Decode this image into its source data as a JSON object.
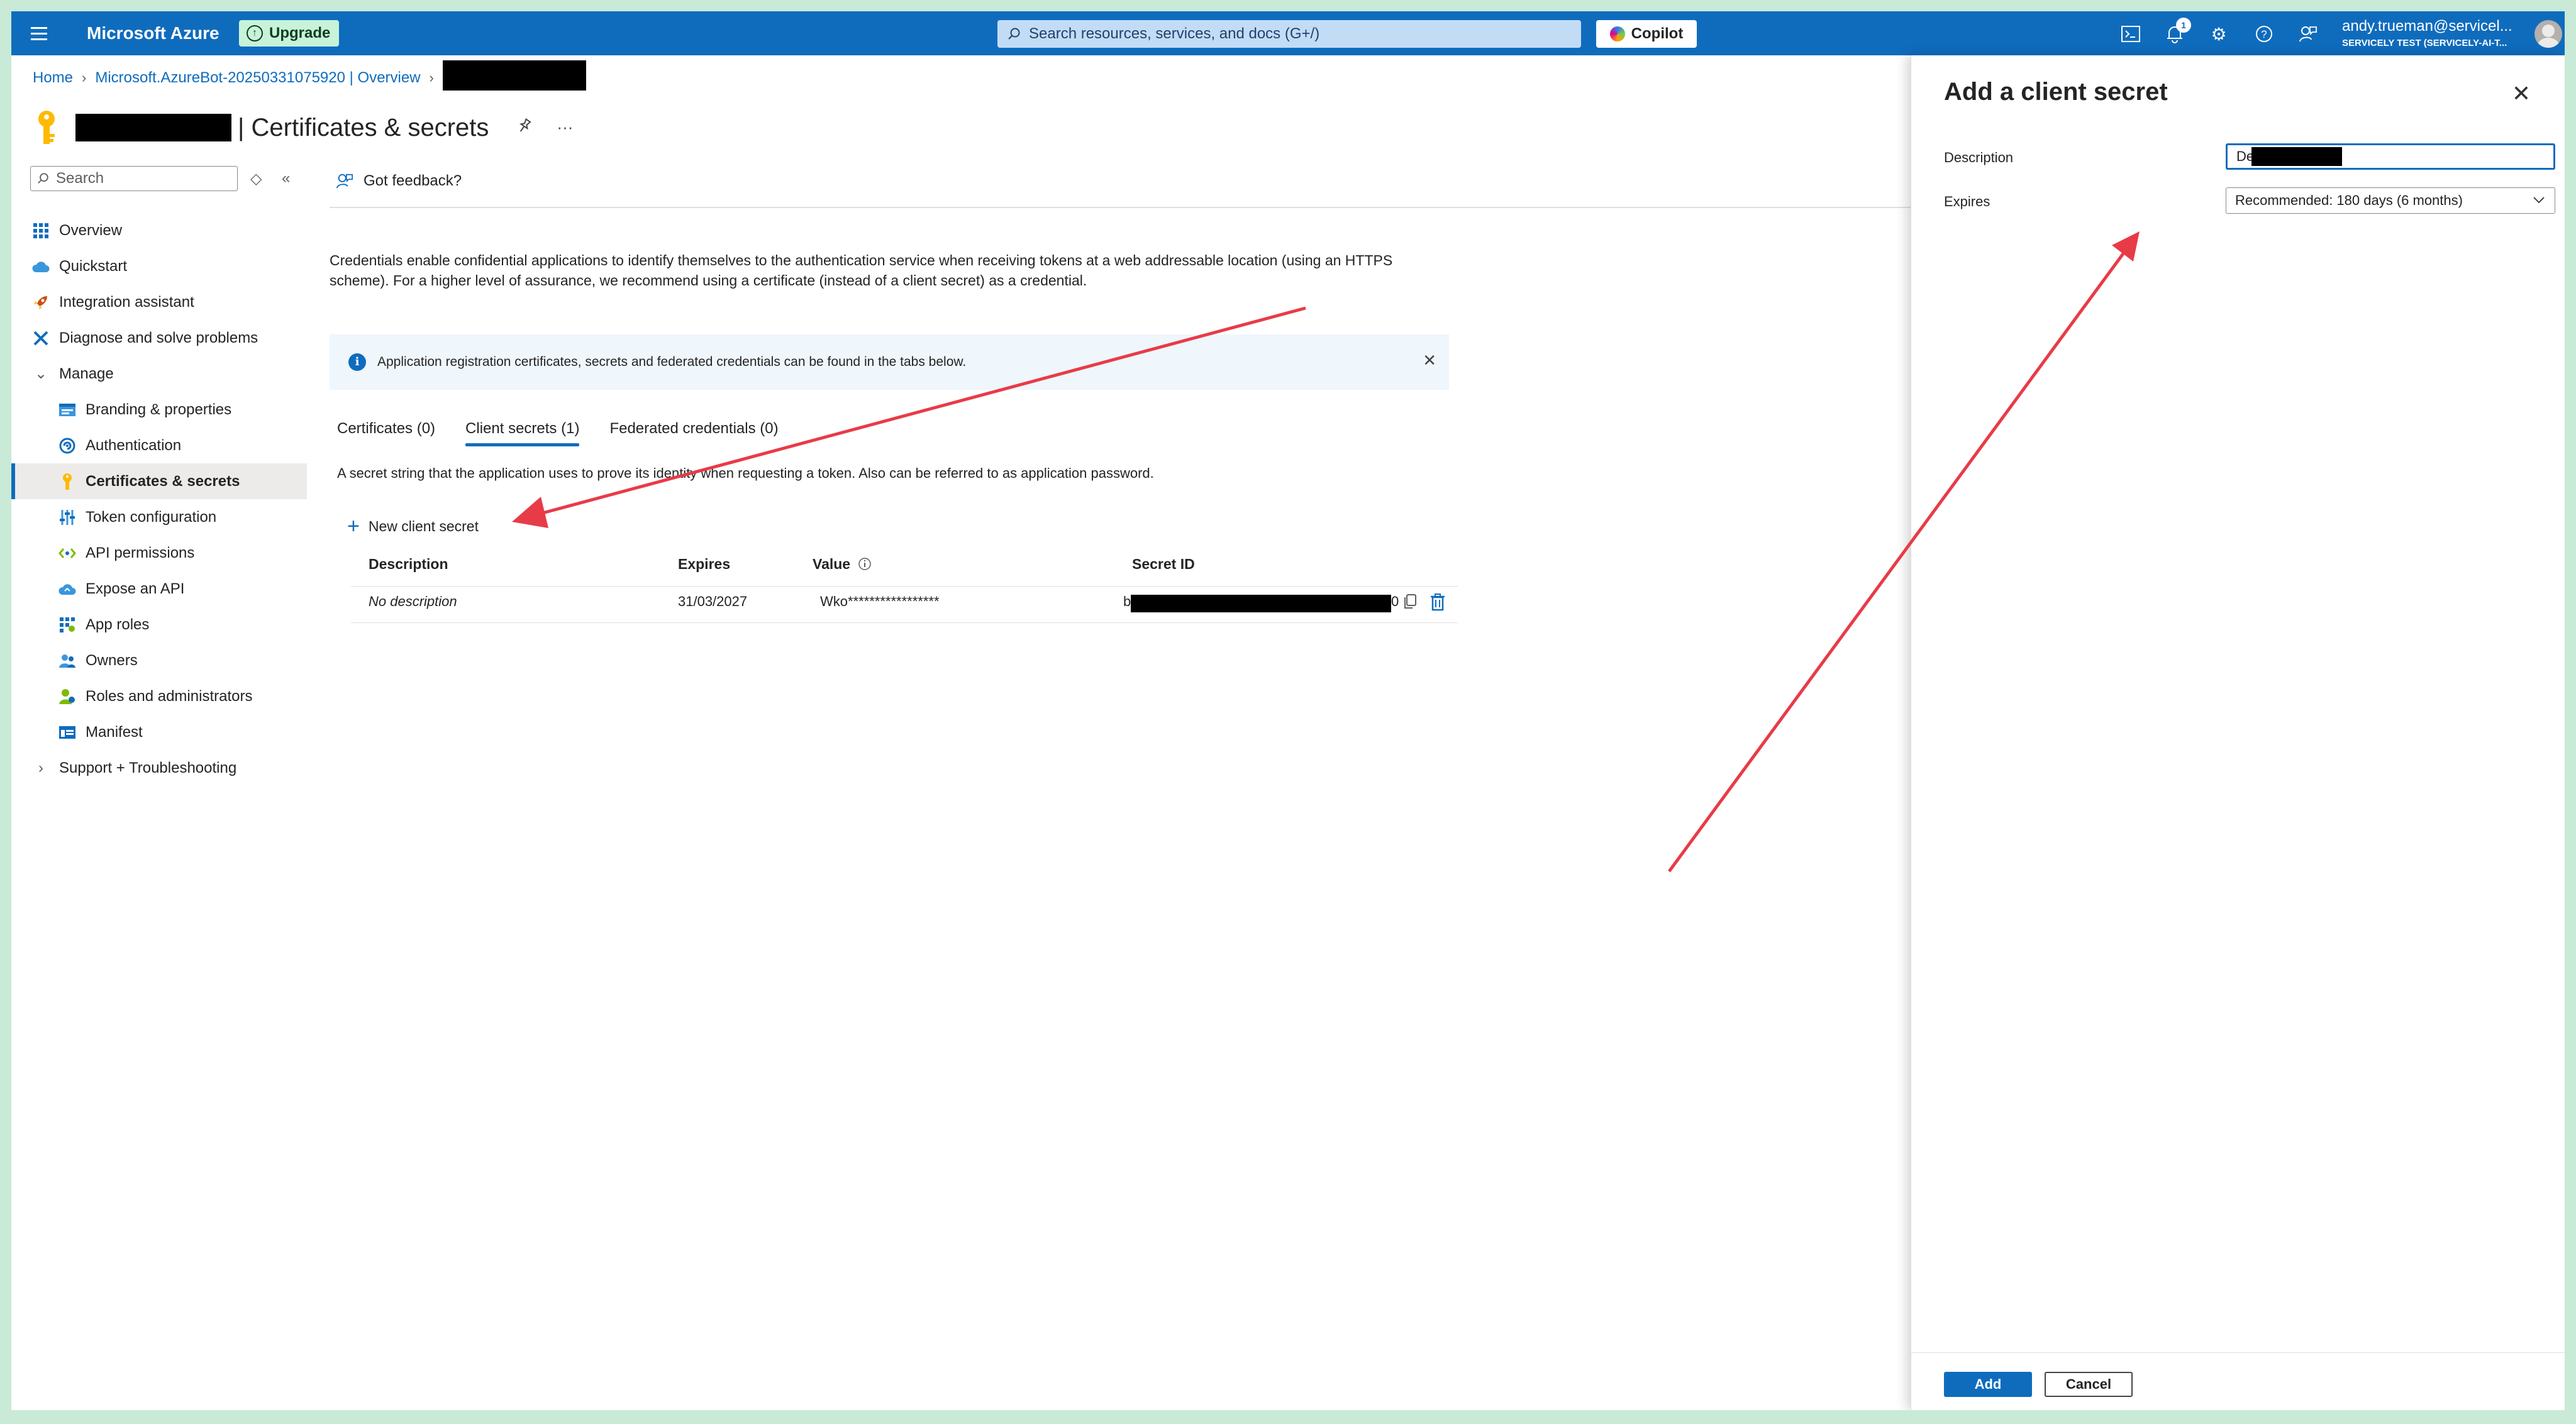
{
  "topbar": {
    "brand": "Microsoft Azure",
    "upgrade_label": "Upgrade",
    "search_placeholder": "Search resources, services, and docs (G+/)",
    "copilot_label": "Copilot",
    "notification_count": "1",
    "user_name": "andy.trueman@servicel...",
    "user_tenant": "SERVICELY TEST (SERVICELY-AI-T..."
  },
  "breadcrumb": {
    "home": "Home",
    "parent": "Microsoft.AzureBot-20250331075920 | Overview"
  },
  "page": {
    "title": "| Certificates & secrets"
  },
  "nav": {
    "search_placeholder": "Search",
    "items": [
      {
        "label": "Overview"
      },
      {
        "label": "Quickstart"
      },
      {
        "label": "Integration assistant"
      },
      {
        "label": "Diagnose and solve problems"
      },
      {
        "label": "Manage"
      },
      {
        "label": "Branding & properties"
      },
      {
        "label": "Authentication"
      },
      {
        "label": "Certificates & secrets"
      },
      {
        "label": "Token configuration"
      },
      {
        "label": "API permissions"
      },
      {
        "label": "Expose an API"
      },
      {
        "label": "App roles"
      },
      {
        "label": "Owners"
      },
      {
        "label": "Roles and administrators"
      },
      {
        "label": "Manifest"
      },
      {
        "label": "Support + Troubleshooting"
      }
    ]
  },
  "main": {
    "feedback_label": "Got feedback?",
    "intro": "Credentials enable confidential applications to identify themselves to the authentication service when receiving tokens at a web addressable location (using an HTTPS scheme). For a higher level of assurance, we recommend using a certificate (instead of a client secret) as a credential.",
    "info_message": "Application registration certificates, secrets and federated credentials can be found in the tabs below.",
    "tabs": [
      {
        "label": "Certificates (0)"
      },
      {
        "label": "Client secrets (1)"
      },
      {
        "label": "Federated credentials (0)"
      }
    ],
    "tab_description": "A secret string that the application uses to prove its identity when requesting a token. Also can be referred to as application password.",
    "new_secret_label": "New client secret",
    "table": {
      "headers": [
        "Description",
        "Expires",
        "Value",
        "Secret ID"
      ],
      "rows": [
        {
          "description": "No description",
          "expires": "31/03/2027",
          "value": "Wko*****************",
          "secret_id_start": "b",
          "secret_id_end": "0"
        }
      ]
    }
  },
  "panel": {
    "title": "Add a client secret",
    "description_label": "Description",
    "description_value": "De",
    "expires_label": "Expires",
    "expires_value": "Recommended: 180 days (6 months)",
    "add_label": "Add",
    "cancel_label": "Cancel"
  },
  "colors": {
    "topbar": "#0f6cbd",
    "accent": "#0f6cbd",
    "annotation": "#e83b48",
    "upgrade_bg": "#c7f3d8",
    "frame_bg": "#c8ead6"
  }
}
